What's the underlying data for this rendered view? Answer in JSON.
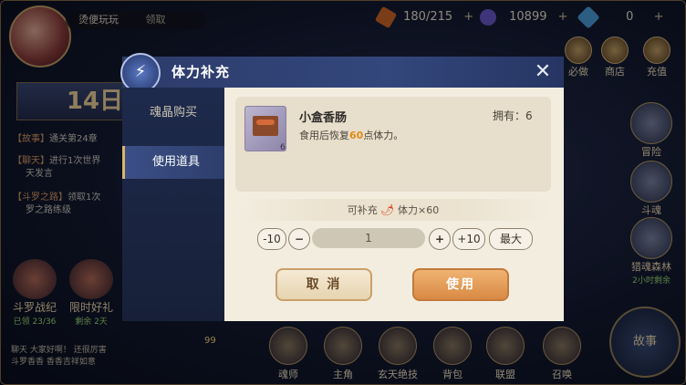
{
  "top_bar": {
    "tag_text": "烫便玩玩",
    "tag_right": "领取",
    "resources": [
      {
        "icon": "stamina-icon",
        "value": "180/215",
        "color": "#d26a2a"
      },
      {
        "icon": "soul-crystal-icon",
        "value": "10899",
        "color": "#6a5ad0"
      },
      {
        "icon": "diamond-icon",
        "value": "0",
        "color": "#4aa3e0"
      }
    ],
    "plus": "+",
    "buttons": [
      {
        "label": "必做"
      },
      {
        "label": "商店"
      },
      {
        "label": "充值"
      }
    ]
  },
  "left_panel": {
    "day_number": "14日",
    "tasks": [
      {
        "tag": "【故事】",
        "text": "通关第24章"
      },
      {
        "tag": "【聊天】",
        "text": "进行1次世界"
      },
      {
        "tag": "",
        "text": "天发言"
      },
      {
        "tag": "【斗罗之路】",
        "text": "领取1次"
      },
      {
        "tag": "",
        "text": "罗之路练级"
      }
    ],
    "features": [
      {
        "label": "斗罗战纪",
        "sub": "已领 23/36"
      },
      {
        "label": "限时好礼",
        "sub": "剩余 2天"
      }
    ],
    "chat_lines": [
      "聊天 大家好啊！ 还很厉害",
      "斗罗香香 香香吉祥如意"
    ]
  },
  "right_panel": {
    "features": [
      {
        "label": "冒险"
      },
      {
        "label": "斗魂"
      },
      {
        "label": "猎魂森林",
        "sub": "2小时剩余"
      }
    ],
    "story_label": "故事"
  },
  "bottom_bar": {
    "badge": "99",
    "buttons": [
      {
        "label": "魂师"
      },
      {
        "label": "主角"
      },
      {
        "label": "玄天绝技"
      },
      {
        "label": "背包"
      },
      {
        "label": "联盟"
      },
      {
        "label": "召唤"
      }
    ]
  },
  "dialog": {
    "title": "体力补充",
    "close_glyph": "✕",
    "tabs": [
      {
        "label": "魂晶购买",
        "active": false
      },
      {
        "label": "使用道具",
        "active": true
      }
    ],
    "item": {
      "name": "小盒香肠",
      "count_on_icon": "6",
      "owned_label": "拥有：6",
      "desc_prefix": "食用后恢复",
      "desc_amount": "60",
      "desc_suffix": "点体力。"
    },
    "restore_prefix": "可补充",
    "restore_suffix": "体力×60",
    "stepper": {
      "minus10": "-10",
      "minus": "−",
      "value": "1",
      "plus": "+",
      "plus10": "+10",
      "max": "最大"
    },
    "cancel_label": "取 消",
    "use_label": "使用"
  }
}
